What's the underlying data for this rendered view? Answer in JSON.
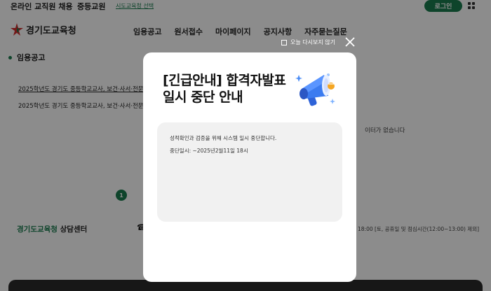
{
  "topbar": {
    "title": "온라인 교직원 채용",
    "category": "중등교원",
    "office_select": "시도교육청 선택",
    "login_label": "로그인"
  },
  "header": {
    "logo_text": "경기도교육청",
    "nav": [
      "임용공고",
      "원서접수",
      "마이페이지",
      "공지사항",
      "자주묻는질문"
    ]
  },
  "main": {
    "section_title": "임용공고",
    "rows": [
      "2025학년도 경기도 중등학교교사, 보건·사서·전문",
      "2025학년도 경기도 중등학교교사, 보건·사서·전문"
    ],
    "right_note": "이터가 없습니다",
    "page_number": "1"
  },
  "consult": {
    "title_green": "경기도교육청",
    "title_rest": " 상담센터",
    "phone_icon": "☎",
    "hours": "18:00 [토, 공휴일 및 점심시간(12:00~13:00) 제외]"
  },
  "popup": {
    "dont_show_label": "오늘 다시보지 않기",
    "title_line1": "[긴급안내] 합격자발표",
    "title_line2": "일시 중단 안내",
    "body_line1": "성적확인과 검증을 위해 시스템 일시 중단합니다.",
    "body_line2": "중단일시: ~2025년2월11일 18시"
  },
  "colors": {
    "brand_green": "#1a7d4f",
    "overlay": "rgba(0,0,0,0.45)"
  },
  "icons": [
    "grid-menu-icon",
    "logo-star-icon",
    "phone-icon",
    "close-icon",
    "megaphone-icon",
    "checkbox-icon"
  ]
}
